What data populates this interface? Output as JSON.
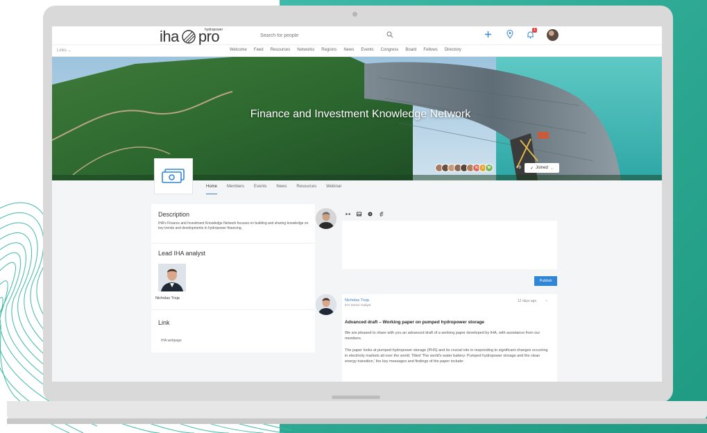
{
  "colors": {
    "teal_background": "#2aa58f",
    "brand_blue": "#2f86d6",
    "link_blue": "#3a7fc4",
    "notification_red": "#e04646"
  },
  "header": {
    "logo_left": "iha",
    "logo_right": "pro",
    "logo_tagline": "hydropower",
    "search_placeholder": "Search for people",
    "notification_count": "1"
  },
  "navbar": {
    "links_dropdown": "Links ⌄",
    "items": [
      "Welcome",
      "Feed",
      "Resources",
      "Networks",
      "Regions",
      "News",
      "Events",
      "Congress",
      "Board",
      "Fellows",
      "Directory"
    ]
  },
  "banner": {
    "title": "Finance and Investment Knowledge Network",
    "member_initials": [
      "K",
      "I",
      "W"
    ],
    "member_count": "+9",
    "joined_label": "Joined"
  },
  "tabs": [
    "Home",
    "Members",
    "Events",
    "News",
    "Resources",
    "Webinar"
  ],
  "left_panel": {
    "description_heading": "Description",
    "description_text": "IHA's Finance and Investment Knowledge Network focuses on building and sharing knowledge on key trends and developments in hydropower financing.",
    "analyst_heading": "Lead IHA analyst",
    "analyst_name": "Nicholas Troja",
    "link_heading": "Link",
    "link_text": "IHA webpage"
  },
  "composer": {
    "publish_label": "Publish"
  },
  "post": {
    "author": "Nicholas Troja",
    "role": "IHA Senior Analyst",
    "time": "12 days ago",
    "title": "Advanced draft – Working paper on pumped hydropower storage",
    "para1": "We are pleased to share with you an advanced draft of a working paper developed by IHA, with assistance from our members.",
    "para2": "The paper looks at pumped hydropower storage (PHS) and its crucial role in responding to significant changes occurring in electricity markets all over the world. Titled 'The world's water battery: Pumped hydropower storage and the clean energy transition,' the key messages and findings of the paper include:"
  }
}
